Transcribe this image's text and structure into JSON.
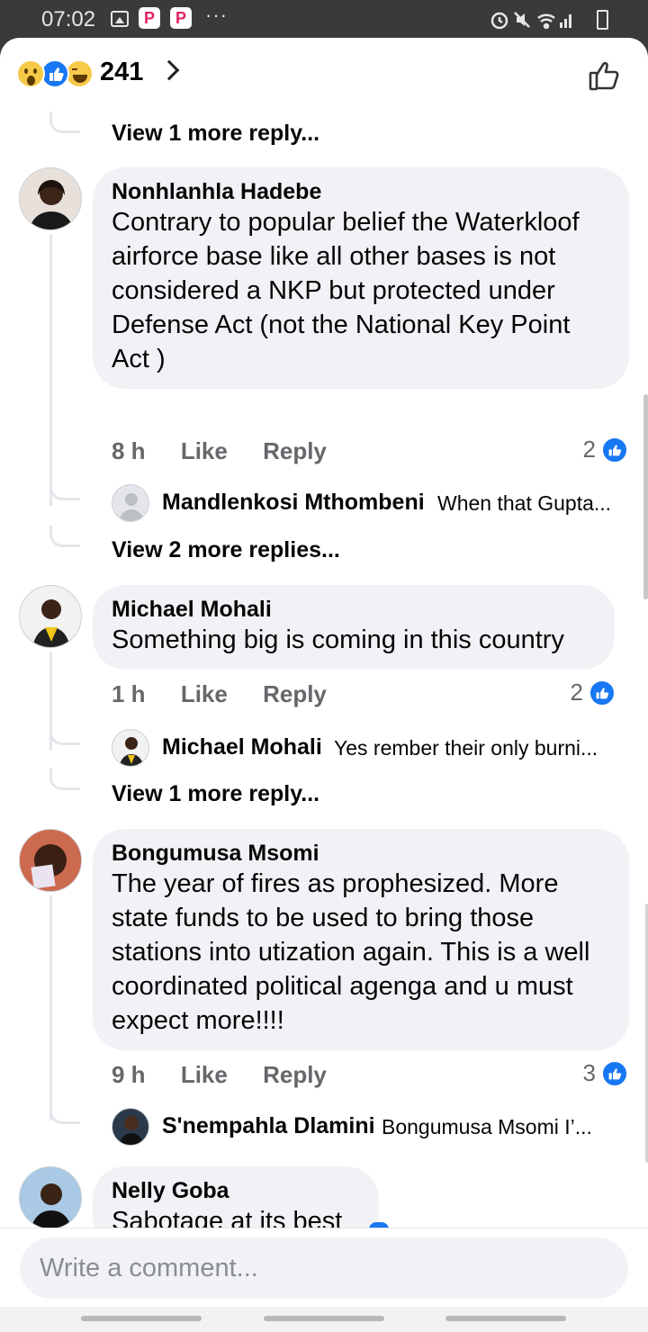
{
  "status_bar": {
    "time": "07:02",
    "app_icon_letter": "P",
    "more": "···",
    "right_icons": [
      "alarm-icon",
      "mute-icon",
      "wifi-icon",
      "signal-icon",
      "battery-icon"
    ]
  },
  "header": {
    "reaction_icons": [
      "wow-reaction-icon",
      "like-reaction-icon",
      "haha-reaction-icon"
    ],
    "reaction_count": "241",
    "accent": "#1877f2"
  },
  "top_thread": {
    "more_replies": "View 1 more reply..."
  },
  "comments": [
    {
      "name": "Nonhlanhla Hadebe",
      "text": "Contrary to popular belief the Waterkloof airforce base like all other bases is not considered a NKP but protected under Defense Act (not the National Key Point Act )",
      "time": "8 h",
      "like_label": "Like",
      "reply_label": "Reply",
      "like_count": "2",
      "reply_preview": {
        "name": "Mandlenkosi Mthombeni",
        "text": "When that Gupta..."
      },
      "more_replies": "View 2 more replies..."
    },
    {
      "name": "Michael Mohali",
      "text": "Something big is coming in this country",
      "time": "1 h",
      "like_label": "Like",
      "reply_label": "Reply",
      "like_count": "2",
      "reply_preview": {
        "name": "Michael Mohali",
        "text": "Yes rember their only burni..."
      },
      "more_replies": "View 1 more reply..."
    },
    {
      "name": "Bongumusa Msomi",
      "text": "The year of fires as prophesized. More state funds to be used to bring those stations into utization again. This is a well coordinated political agenga and u must expect more!!!!",
      "time": "9 h",
      "like_label": "Like",
      "reply_label": "Reply",
      "like_count": "3",
      "reply_preview": {
        "name": "S'nempahla Dlamini",
        "text": "Bongumusa Msomi I’..."
      }
    },
    {
      "name": "Nelly Goba",
      "text": "Sabotage at its best"
    }
  ],
  "composer": {
    "placeholder": "Write a comment..."
  }
}
